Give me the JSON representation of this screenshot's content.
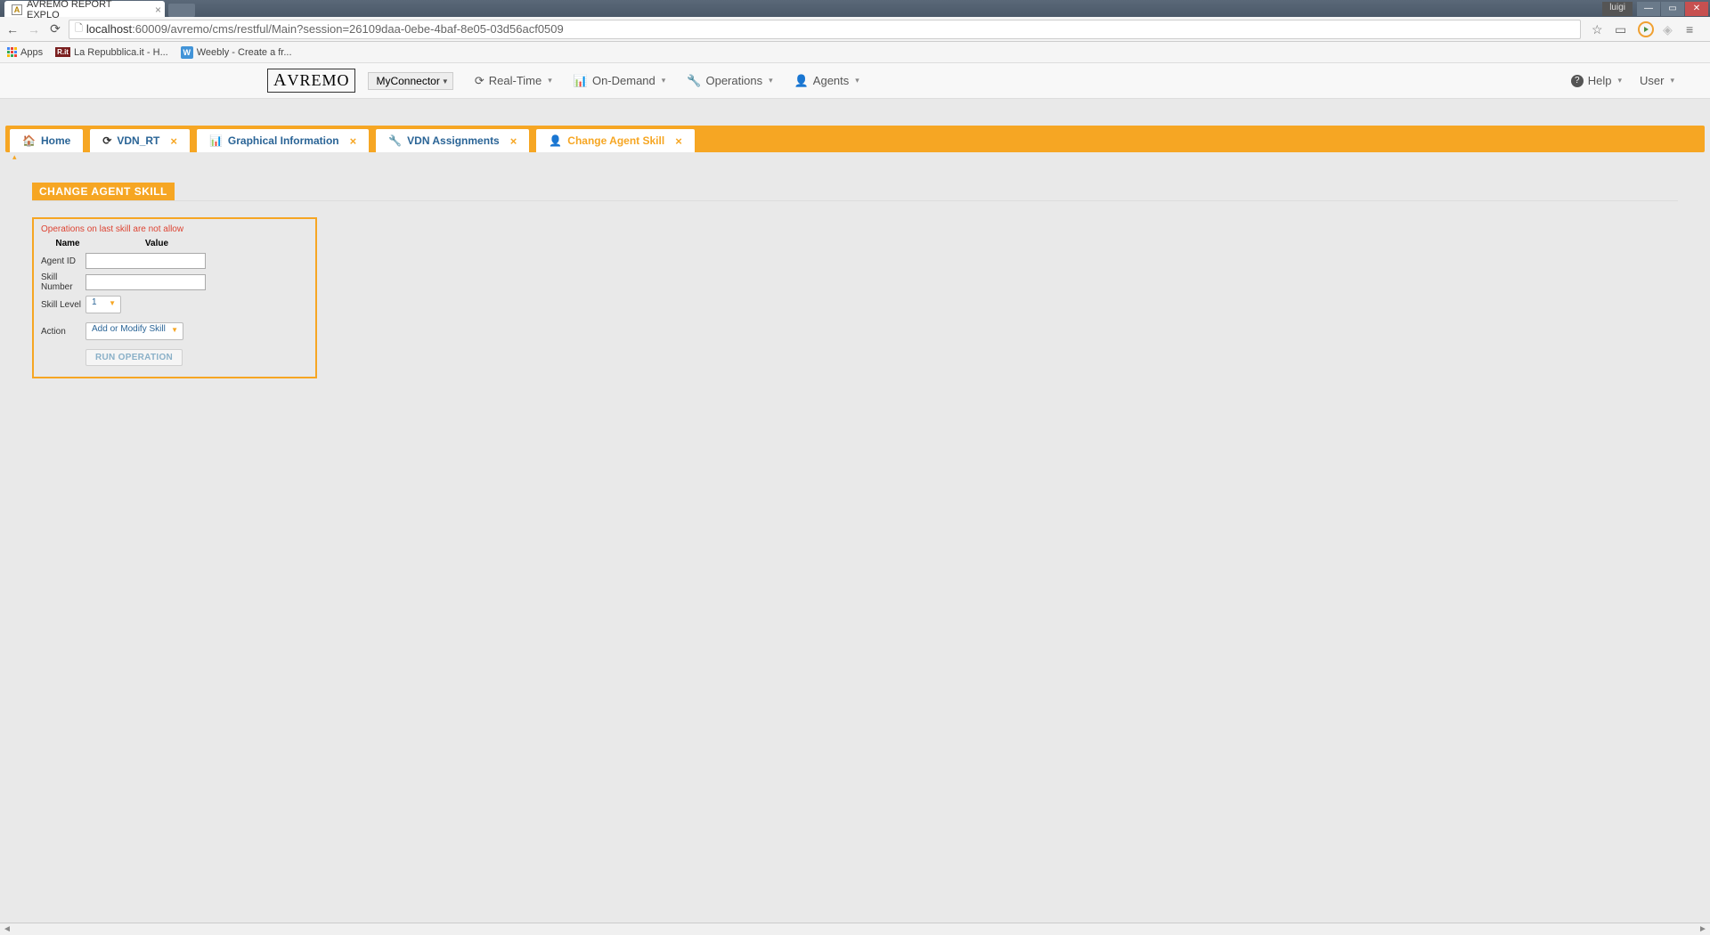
{
  "browser": {
    "tab_title": "AVREMO REPORT EXPLO",
    "user_badge": "luigi",
    "url_host": "localhost",
    "url_port_path": ":60009/avremo/cms/restful/Main?session=26109daa-0ebe-4baf-8e05-03d56acf0509"
  },
  "bookmarks": {
    "apps": "Apps",
    "repubblica": "La Repubblica.it - H...",
    "weebly": "Weebly - Create a fr..."
  },
  "header": {
    "logo_text": "AVREMO",
    "connector": "MyConnector",
    "menu": {
      "realtime": "Real-Time",
      "ondemand": "On-Demand",
      "operations": "Operations",
      "agents": "Agents",
      "help": "Help",
      "user": "User"
    }
  },
  "tabs": [
    {
      "label": "Home",
      "closable": false
    },
    {
      "label": "VDN_RT",
      "closable": true
    },
    {
      "label": "Graphical Information",
      "closable": true
    },
    {
      "label": "VDN Assignments",
      "closable": true
    },
    {
      "label": "Change Agent Skill",
      "closable": true,
      "active": true
    }
  ],
  "section_title": "CHANGE AGENT SKILL",
  "form": {
    "warning": "Operations on last skill are not allow",
    "header_name": "Name",
    "header_value": "Value",
    "labels": {
      "agent_id": "Agent ID",
      "skill_number": "Skill Number",
      "skill_level": "Skill Level",
      "action": "Action"
    },
    "values": {
      "agent_id": "",
      "skill_number": "",
      "skill_level": "1",
      "action": "Add or Modify Skill"
    },
    "run_button": "RUN OPERATION"
  }
}
